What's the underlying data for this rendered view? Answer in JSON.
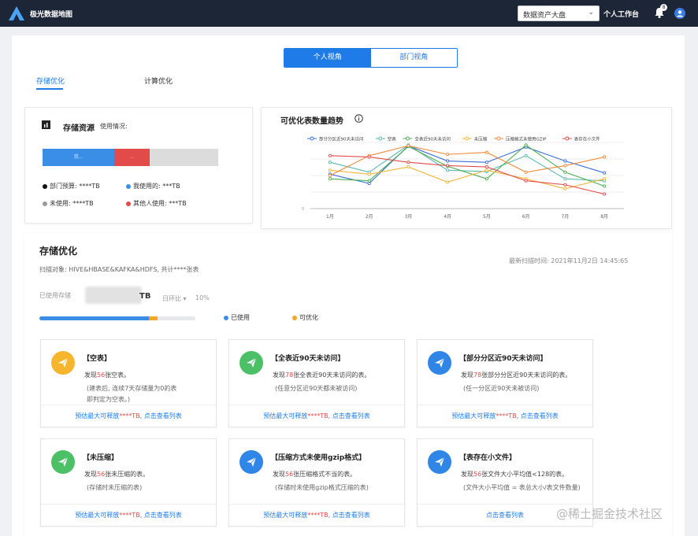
{
  "header": {
    "app_title": "极光数据地图",
    "dropdown_value": "数据资产大盘",
    "workbench": "个人工作台",
    "notification_count": "8",
    "brand_color": "#1d2637",
    "accent_color": "#1f7be8"
  },
  "view_toggle": {
    "personal": "个人视角",
    "department": "部门视角"
  },
  "tabs": {
    "storage": "存储优化",
    "compute": "计算优化"
  },
  "storage_resources": {
    "title": "存储资源",
    "usage_label": "使用情况:",
    "bar_segment_mine": "我...",
    "bar_segment_others": "...",
    "usage_fractions": {
      "mine": 0.41,
      "others": 0.2,
      "unused": 0.39
    },
    "legend": [
      {
        "label": "部门预算: ****TB",
        "color": "#111111"
      },
      {
        "label": "我使用的: ***TB",
        "color": "#3a8ee6"
      },
      {
        "label": "未使用: ****TB",
        "color": "#999999"
      },
      {
        "label": "其他人使用: ***TB",
        "color": "#e34b4b"
      }
    ]
  },
  "chart_data": {
    "type": "line",
    "title": "可优化表数量趋势",
    "categories": [
      "1月",
      "2月",
      "3月",
      "4月",
      "5月",
      "6月",
      "7月",
      "8月"
    ],
    "ylim": [
      0,
      10
    ],
    "grid": true,
    "legend_position": "top",
    "series": [
      {
        "name": "部分分区近90天未访问",
        "color": "#3a6fd8",
        "values": [
          5.2,
          3.8,
          9.5,
          7.2,
          7.0,
          9.3,
          7.2,
          5.4
        ]
      },
      {
        "name": "空表",
        "color": "#5ab8b0",
        "values": [
          7.0,
          5.5,
          9.6,
          5.8,
          5.6,
          8.0,
          4.5,
          4.2
        ]
      },
      {
        "name": "全表近90天未访问",
        "color": "#4caf50",
        "values": [
          4.5,
          4.2,
          9.4,
          6.4,
          4.5,
          9.6,
          5.5,
          3.4
        ]
      },
      {
        "name": "未压缩",
        "color": "#f0b63a",
        "values": [
          5.8,
          5.2,
          6.3,
          4.0,
          5.8,
          4.5,
          3.0,
          4.5
        ]
      },
      {
        "name": "压缩格式未使用GZIP",
        "color": "#f08a3a",
        "values": [
          5.0,
          8.0,
          9.5,
          8.2,
          8.5,
          5.5,
          6.5,
          7.8
        ]
      },
      {
        "name": "表存在小文件",
        "color": "#e34b4b",
        "values": [
          8.0,
          7.8,
          7.0,
          6.5,
          6.3,
          4.2,
          3.6,
          2.2
        ]
      }
    ]
  },
  "optimization": {
    "title": "存储优化",
    "scan_target": "扫描对象: HIVE&HBASE&KAFKA&HDFS, 共计****张表",
    "last_scan": "最新扫描时间: 2021年11月2日 14:45:65",
    "used_storage_label": "已使用存储",
    "used_storage_unit": "TB",
    "period_compare": "日环比 ▾",
    "period_change": "10%",
    "progress": {
      "used": 0.7,
      "optimizable": 0.06
    },
    "legend_used": "已使用",
    "legend_optimizable": "可优化",
    "cards": [
      {
        "title": "【空表】",
        "count_prefix": "发现",
        "count": "56",
        "count_suffix": "张空表。",
        "note1": "(建表后, 连续7天存储量为0的表",
        "note2": "即判定为空表。)",
        "footer_prefix": "预估最大可释放",
        "footer_value": "****TB",
        "footer_suffix": ", 点击查看列表",
        "icon_color": "#f5b62e"
      },
      {
        "title": "【全表近90天未访问】",
        "count_prefix": "发现",
        "count": "78",
        "count_suffix": "张全表近90天未访问的表。",
        "note1": "(任意分区近90天都未被访问)",
        "note2": "",
        "footer_prefix": "预估最大可释放",
        "footer_value": "****TB",
        "footer_suffix": ", 点击查看列表",
        "icon_color": "#4cc066"
      },
      {
        "title": "【部分分区近90天未访问】",
        "count_prefix": "发现",
        "count": "78",
        "count_suffix": "张部分分区近90天未访问的表。",
        "note1": "(任一分区近90天未被访问)",
        "note2": "",
        "footer_prefix": "预估最大可释放",
        "footer_value": "****TB",
        "footer_suffix": ", 点击查看列表",
        "icon_color": "#2f86e6"
      },
      {
        "title": "【未压缩】",
        "count_prefix": "发现",
        "count": "56",
        "count_suffix": "张未压缩的表。",
        "note1": "(存储时未压缩的表)",
        "note2": "",
        "footer_prefix": "预估最大可释放",
        "footer_value": "****TB",
        "footer_suffix": ", 点击查看列表",
        "icon_color": "#4cc066"
      },
      {
        "title": "【压缩方式未使用gzip格式】",
        "count_prefix": "发现",
        "count": "56",
        "count_suffix": "张压缩格式不当的表。",
        "note1": "(存储时未使用gzip格式压缩的表)",
        "note2": "",
        "footer_prefix": "预估最大可释放",
        "footer_value": "****TB",
        "footer_suffix": ", 点击查看列表",
        "icon_color": "#2f86e6"
      },
      {
        "title": "【表存在小文件】",
        "count_prefix": "发现",
        "count": "56",
        "count_suffix": "张文件大小平均值<128的表。",
        "note1": "(文件大小平均值 = 表总大小/表文件数量)",
        "note2": "",
        "footer_prefix": "",
        "footer_value": "",
        "footer_suffix": "点击查看列表",
        "icon_color": "#2f86e6"
      }
    ]
  },
  "watermark": "@稀土掘金技术社区"
}
